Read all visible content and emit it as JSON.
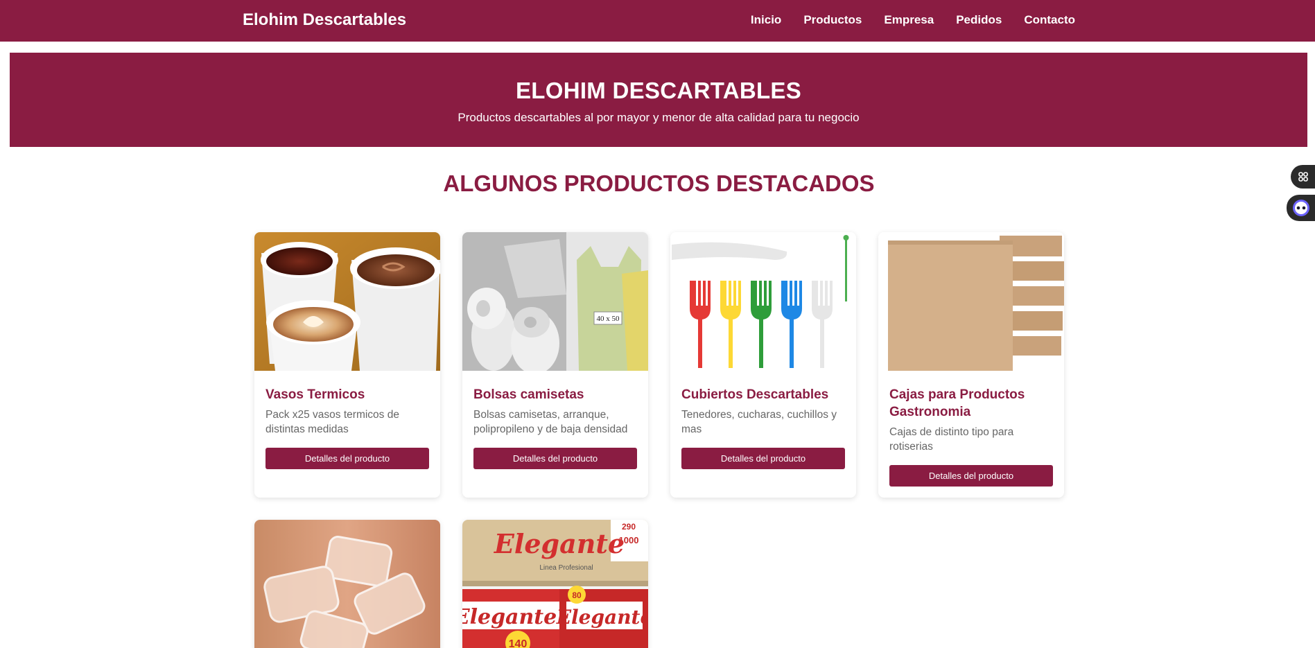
{
  "navbar": {
    "brand": "Elohim Descartables",
    "links": [
      "Inicio",
      "Productos",
      "Empresa",
      "Pedidos",
      "Contacto"
    ]
  },
  "hero": {
    "title": "ELOHIM DESCARTABLES",
    "subtitle": "Productos descartables al por mayor y menor de alta calidad para tu negocio"
  },
  "section": {
    "title": "ALGUNOS PRODUCTOS DESTACADOS"
  },
  "products": [
    {
      "title": "Vasos Termicos",
      "description": "Pack x25 vasos termicos de distintas medidas",
      "button": "Detalles del producto",
      "image": "foam-cups-image"
    },
    {
      "title": "Bolsas camisetas",
      "description": "Bolsas camisetas, arranque, polipropileno y de baja densidad",
      "button": "Detalles del producto",
      "image": "plastic-bags-image",
      "image_text": "40 x 50"
    },
    {
      "title": "Cubiertos Descartables",
      "description": "Tenedores, cucharas, cuchillos y mas",
      "button": "Detalles del producto",
      "image": "plastic-forks-image"
    },
    {
      "title": "Cajas para Productos Gastronomia",
      "description": "Cajas de distinto tipo para rotiserias",
      "button": "Detalles del producto",
      "image": "cardboard-boxes-image"
    },
    {
      "title": "",
      "description": "",
      "button": "",
      "image": "plastic-trays-image"
    },
    {
      "title": "",
      "description": "",
      "button": "",
      "image": "napkins-image",
      "image_text": [
        "Elegante",
        "Linea Profesional",
        "290",
        "1000",
        "Elegante",
        "140",
        "Elegante",
        "80"
      ]
    }
  ],
  "side_widgets": [
    {
      "icon": "command-icon"
    },
    {
      "icon": "assistant-bot-icon"
    }
  ],
  "colors": {
    "primary": "#8a1c42",
    "white": "#ffffff"
  }
}
